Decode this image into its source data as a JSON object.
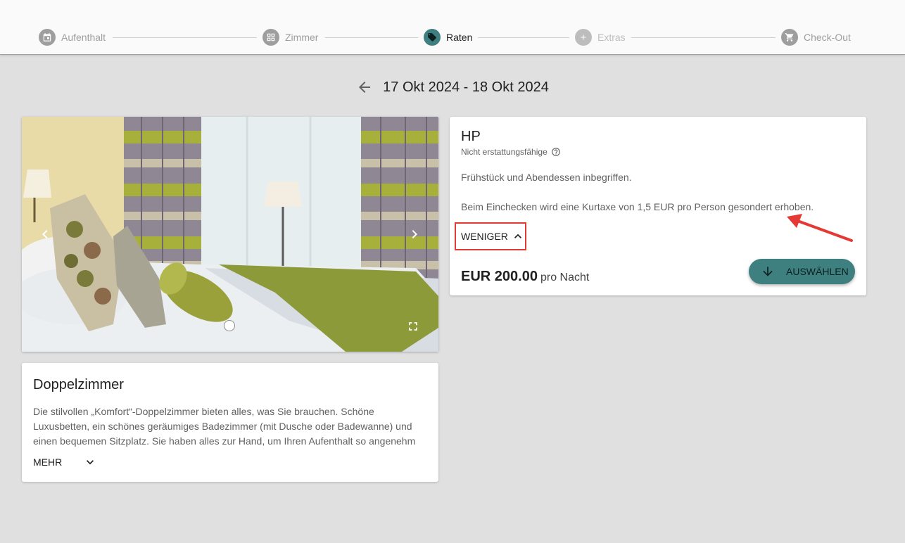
{
  "stepper": {
    "steps": [
      {
        "label": "Aufenthalt",
        "icon": "calendar-icon",
        "state": "done"
      },
      {
        "label": "Zimmer",
        "icon": "grid-icon",
        "state": "done"
      },
      {
        "label": "Raten",
        "icon": "tag-icon",
        "state": "active"
      },
      {
        "label": "Extras",
        "icon": "plus-icon",
        "state": "disabled"
      },
      {
        "label": "Check-Out",
        "icon": "cart-icon",
        "state": "done"
      }
    ]
  },
  "header": {
    "date_range": "17 Okt 2024 - 18 Okt 2024",
    "back_icon": "arrow-left-icon"
  },
  "room": {
    "title": "Doppelzimmer",
    "description": "Die stilvollen „Komfort“-Doppelzimmer bieten alles, was Sie brauchen. Schöne Luxusbetten, ein schönes geräumiges Badezimmer (mit Dusche oder Badewanne) und einen bequemen Sitzplatz. Sie haben alles zur Hand, um Ihren Aufenthalt so angenehm …",
    "more_label": "MEHR"
  },
  "rate": {
    "title": "HP",
    "subtitle": "Nicht erstattungsfähige",
    "description_line1": "Frühstück und Abendessen inbegriffen.",
    "description_line2": "Beim Einchecken wird eine Kurtaxe von 1,5 EUR pro Person gesondert erhoben.",
    "less_label": "WENIGER",
    "price": "EUR 200.00",
    "price_unit": "pro Nacht",
    "select_label": "AUSWÄHLEN"
  },
  "colors": {
    "accent": "#3e7f7f",
    "background": "#e0e0e0",
    "highlight": "#e53935"
  }
}
